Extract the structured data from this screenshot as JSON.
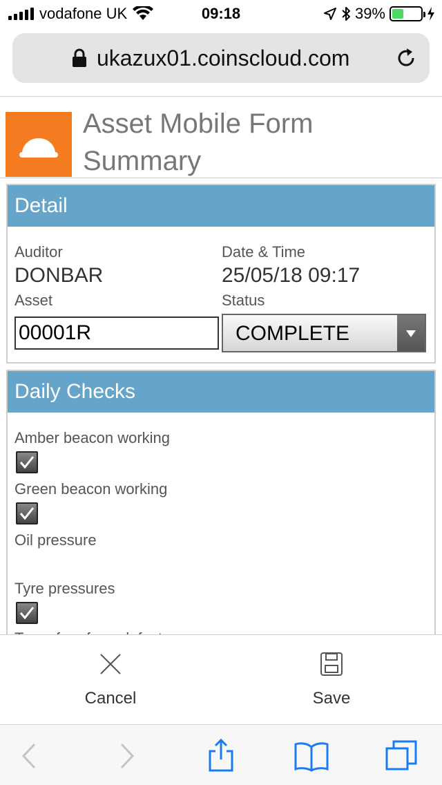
{
  "status_bar": {
    "carrier": "vodafone UK",
    "time": "09:18",
    "battery": "39%",
    "battery_level": 0.39
  },
  "browser": {
    "url": "ukazux01.coinscloud.com"
  },
  "page": {
    "title": "Asset Mobile Form Summary"
  },
  "detail": {
    "heading": "Detail",
    "auditor_label": "Auditor",
    "auditor_value": "DONBAR",
    "datetime_label": "Date & Time",
    "datetime_value": "25/05/18 09:17",
    "asset_label": "Asset",
    "asset_value": "00001R",
    "status_label": "Status",
    "status_value": "COMPLETE"
  },
  "daily_checks": {
    "heading": "Daily Checks",
    "items": [
      {
        "label": "Amber beacon working",
        "checked": true
      },
      {
        "label": "Green beacon working",
        "checked": true
      },
      {
        "label": "Oil pressure",
        "checked": false
      },
      {
        "label": "Tyre pressures",
        "checked": true
      },
      {
        "label": "Tyres free from defects",
        "checked": false
      }
    ]
  },
  "actions": {
    "cancel_label": "Cancel",
    "save_label": "Save"
  }
}
